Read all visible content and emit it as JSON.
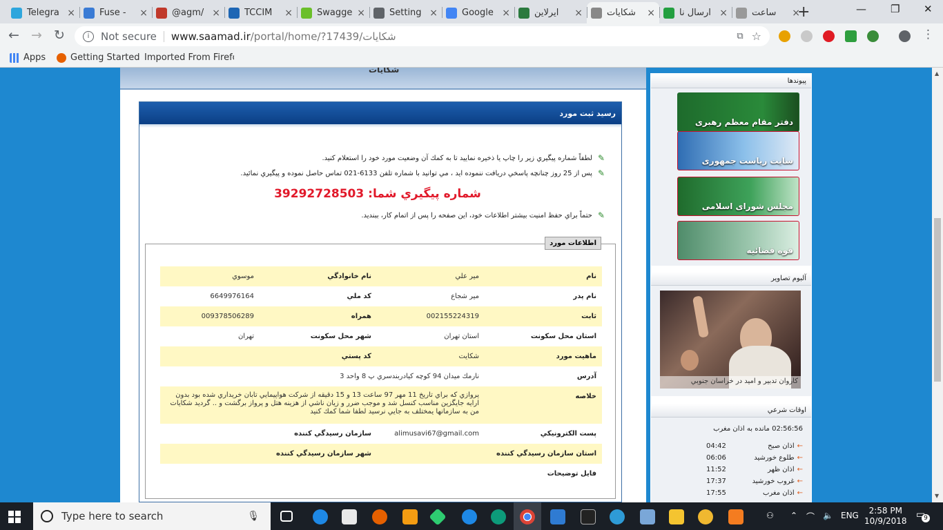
{
  "browser": {
    "tabs": [
      {
        "title": "Telegra",
        "icon": "telegram-icon",
        "color": "#2ea6dd"
      },
      {
        "title": "Fuse - ",
        "icon": "fuse-icon",
        "color": "#3a7bd5"
      },
      {
        "title": "@agm/",
        "icon": "agm-icon",
        "color": "#c0392b"
      },
      {
        "title": "TCCIM",
        "icon": "tccim-icon",
        "color": "#1e66b4"
      },
      {
        "title": "Swagge",
        "icon": "swagger-icon",
        "color": "#6bbf2a"
      },
      {
        "title": "Setting",
        "icon": "settings-icon",
        "color": "#5f6368"
      },
      {
        "title": "Google",
        "icon": "google-icon",
        "color": "#4285f4"
      },
      {
        "title": "ايرلاين",
        "icon": "airline-icon",
        "color": "#2b7a3e"
      },
      {
        "title": "شكايات",
        "icon": "page-icon",
        "color": "#888888",
        "active": true
      },
      {
        "title": "ارسال نا",
        "icon": "iran-flag-icon",
        "color": "#239f40"
      },
      {
        "title": "ساعت",
        "icon": "clock-icon",
        "color": "#999999"
      }
    ],
    "new_tab": "+",
    "window_controls": {
      "minimize": "—",
      "restore": "❐",
      "close": "✕"
    },
    "address": {
      "security": "Not secure",
      "host": "www.saamad.ir",
      "path": "/portal/home/?17439/شكايات"
    },
    "bookmarks": [
      {
        "label": "Apps",
        "icon": "apps-icon"
      },
      {
        "label": "Getting Started",
        "icon": "firefox-icon"
      },
      {
        "label": "Imported From Firefo",
        "icon": "folder-icon"
      }
    ]
  },
  "page": {
    "header_title": "شكايات",
    "panel_title": "رسید ثبت مورد",
    "notes": [
      "لطفاً شماره پيگيري زير را چاپ يا ذخيره نماييد تا به كمك آن وضعيت مورد خود را استعلام كنيد.",
      "پس از 25 روز چنانچه پاسخي دريافت ننموده ايد ، مي توانيد با شماره تلفن 6133-021 تماس حاصل نموده و پيگيري نمائيد.",
      "حتماً براي حفظ امنيت بيشتر اطلاعات خود، اين صفحه را پس از اتمام كار، ببنديد."
    ],
    "tracking_label": "شماره پيگيري شما:",
    "tracking_number": "39292728503",
    "info_legend": "اطلاعات مورد",
    "rows": [
      {
        "l1": "نام",
        "v1": "مير علي",
        "l2": "نام خانوادگي",
        "v2": "موسوي",
        "alt": true
      },
      {
        "l1": "نام پدر",
        "v1": "مير شجاع",
        "l2": "كد ملي",
        "v2": "6649976164",
        "alt": false
      },
      {
        "l1": "ثابت",
        "v1": "002155224319",
        "l2": "همراه",
        "v2": "009378506289",
        "alt": true
      },
      {
        "l1": "استان محل سكونت",
        "v1": "استان تهران",
        "l2": "شهر محل سكونت",
        "v2": "تهران",
        "alt": false
      },
      {
        "l1": "ماهيت مورد",
        "v1": "شكايت",
        "l2": "كد پستي",
        "v2": "",
        "alt": true
      },
      {
        "l1": "آدرس",
        "v1": "نارمك ميدان 94 كوچه كيادربندسري پ 8 واحد 3",
        "l2": "",
        "v2": "",
        "alt": false
      },
      {
        "l1": "خلاصه",
        "v1": "پروازي كه براي تاريخ 11 مهر 97 ساعت 13 و 15 دقيقه از شركت هواپيمايي تابان خريداري شده بود بدون ارايه جايگزين مناسب كنسل شد و موجب ضرر و زيان ناشي از هزينه هتل و پرواز برگشت و .. گرديد شكايات من به سازمانها يمختلف به جايي نرسيد لطفا شما كمك كنيد",
        "l2": "",
        "v2": "",
        "alt": true
      },
      {
        "l1": "پست الكترونيكي",
        "v1": "alimusavi67@gmail.com",
        "l2": "سازمان رسيدگي كننده",
        "v2": "",
        "alt": false
      },
      {
        "l1": "استان سازمان رسيدگي كننده",
        "v1": "",
        "l2": "شهر سازمان رسيدگي كننده",
        "v2": "",
        "alt": true
      },
      {
        "l1": "فايل توضيحات",
        "v1": "",
        "l2": "",
        "v2": "",
        "alt": false
      }
    ]
  },
  "sidebar": {
    "links_title": "پيوندها",
    "banners": [
      {
        "label": "دفتر مقام معظم رهبری",
        "color": "#1e6b2c"
      },
      {
        "label": "سایت ریاست جمهوری",
        "color": "#4b8fd0"
      },
      {
        "label": "مجلس شورای اسلامی",
        "color": "#2d8a3c"
      },
      {
        "label": "قوه قضائیه",
        "color": "#7ba88c"
      }
    ],
    "album_title": "آلبوم تصاوير",
    "album_caption": "كاروان تدبير و اميد در خراسان جنوبي",
    "prayer_title": "اوقات شرعي",
    "countdown": "02:56:56",
    "countdown_label": "مانده به اذان مغرب",
    "prayers": [
      {
        "name": "اذان صبح",
        "time": "04:42"
      },
      {
        "name": "طلوع خورشيد",
        "time": "06:06"
      },
      {
        "name": "اذان ظهر",
        "time": "11:52"
      },
      {
        "name": "غروب خورشيد",
        "time": "17:37"
      },
      {
        "name": "اذان مغرب",
        "time": "17:55"
      }
    ]
  },
  "taskbar": {
    "search_placeholder": "Type here to search",
    "language": "ENG",
    "time": "2:58 PM",
    "date": "10/9/2018",
    "notifications": "9"
  }
}
